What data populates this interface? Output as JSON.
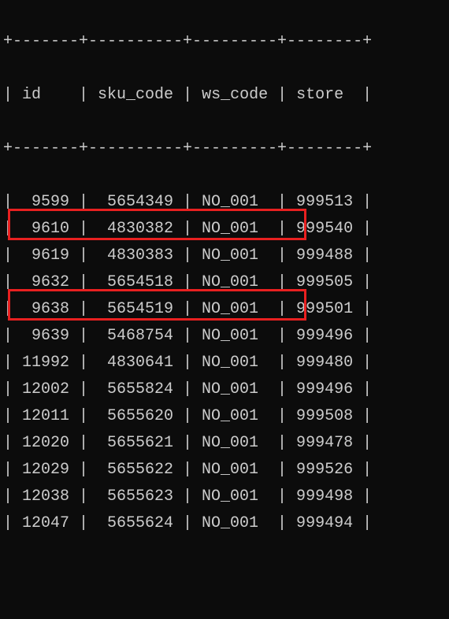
{
  "border_top": "+-------+----------+---------+--------+",
  "header": {
    "id": "id",
    "sku_code": "sku_code",
    "ws_code": "ws_code",
    "store": "store"
  },
  "border_mid": "+-------+----------+---------+--------+",
  "rows": [
    {
      "id": "9599",
      "sku_code": "5654349",
      "ws_code": "NO_001",
      "store": "999513"
    },
    {
      "id": "9610",
      "sku_code": "4830382",
      "ws_code": "NO_001",
      "store": "999540"
    },
    {
      "id": "9619",
      "sku_code": "4830383",
      "ws_code": "NO_001",
      "store": "999488"
    },
    {
      "id": "9632",
      "sku_code": "5654518",
      "ws_code": "NO_001",
      "store": "999505"
    },
    {
      "id": "9638",
      "sku_code": "5654519",
      "ws_code": "NO_001",
      "store": "999501"
    },
    {
      "id": "9639",
      "sku_code": "5468754",
      "ws_code": "NO_001",
      "store": "999496"
    },
    {
      "id": "11992",
      "sku_code": "4830641",
      "ws_code": "NO_001",
      "store": "999480"
    },
    {
      "id": "12002",
      "sku_code": "5655824",
      "ws_code": "NO_001",
      "store": "999496"
    },
    {
      "id": "12011",
      "sku_code": "5655620",
      "ws_code": "NO_001",
      "store": "999508"
    },
    {
      "id": "12020",
      "sku_code": "5655621",
      "ws_code": "NO_001",
      "store": "999478"
    },
    {
      "id": "12029",
      "sku_code": "5655622",
      "ws_code": "NO_001",
      "store": "999526"
    },
    {
      "id": "12038",
      "sku_code": "5655623",
      "ws_code": "NO_001",
      "store": "999498"
    },
    {
      "id": "12047",
      "sku_code": "5655624",
      "ws_code": "NO_001",
      "store": "999494"
    }
  ],
  "chart_data": {
    "type": "table",
    "headers": [
      "id",
      "sku_code",
      "ws_code",
      "store"
    ],
    "rows": [
      [
        9599,
        5654349,
        "NO_001",
        999513
      ],
      [
        9610,
        4830382,
        "NO_001",
        999540
      ],
      [
        9619,
        4830383,
        "NO_001",
        999488
      ],
      [
        9632,
        5654518,
        "NO_001",
        999505
      ],
      [
        9638,
        5654519,
        "NO_001",
        999501
      ],
      [
        9639,
        5468754,
        "NO_001",
        999496
      ],
      [
        11992,
        4830641,
        "NO_001",
        999480
      ],
      [
        12002,
        5655824,
        "NO_001",
        999496
      ],
      [
        12011,
        5655620,
        "NO_001",
        999508
      ],
      [
        12020,
        5655621,
        "NO_001",
        999478
      ],
      [
        12029,
        5655622,
        "NO_001",
        999526
      ],
      [
        12038,
        5655623,
        "NO_001",
        999498
      ],
      [
        12047,
        5655624,
        "NO_001",
        999494
      ]
    ],
    "highlighted_rows": [
      5,
      8
    ]
  }
}
